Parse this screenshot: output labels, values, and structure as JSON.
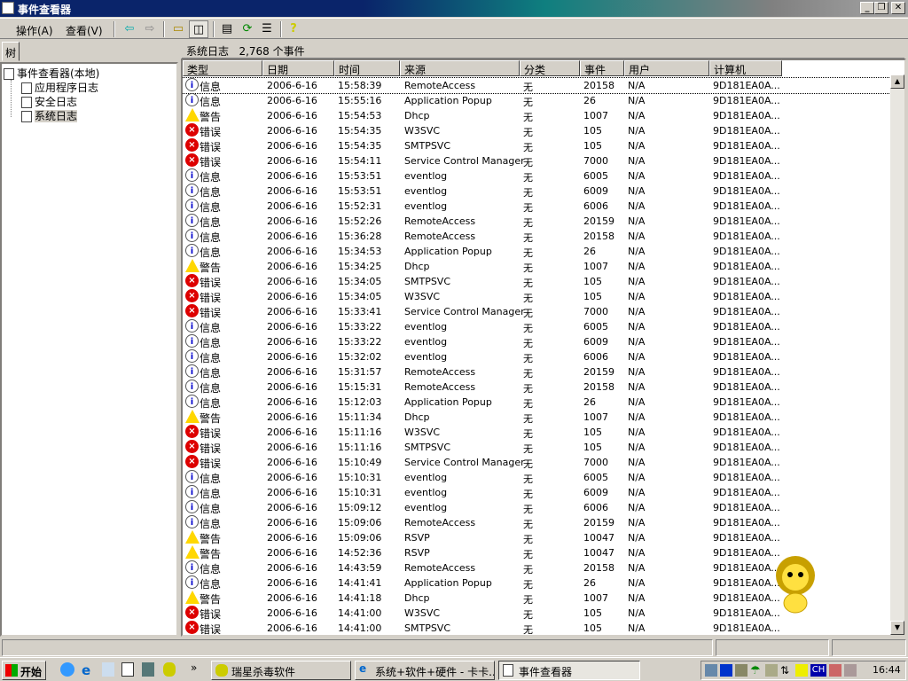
{
  "window": {
    "title": "事件查看器"
  },
  "menu": {
    "action": "操作(A)",
    "view": "查看(V)"
  },
  "tree": {
    "tab": "树",
    "root": "事件查看器(本地)",
    "items": [
      "应用程序日志",
      "安全日志",
      "系统日志"
    ]
  },
  "list": {
    "header": "系统日志   2,768 个事件",
    "columns": [
      "类型",
      "日期",
      "时间",
      "来源",
      "分类",
      "事件",
      "用户",
      "计算机"
    ],
    "rows": [
      [
        "信息",
        "2006-6-16",
        "15:58:39",
        "RemoteAccess",
        "无",
        "20158",
        "N/A",
        "9D181EA0A..."
      ],
      [
        "信息",
        "2006-6-16",
        "15:55:16",
        "Application Popup",
        "无",
        "26",
        "N/A",
        "9D181EA0A..."
      ],
      [
        "警告",
        "2006-6-16",
        "15:54:53",
        "Dhcp",
        "无",
        "1007",
        "N/A",
        "9D181EA0A..."
      ],
      [
        "错误",
        "2006-6-16",
        "15:54:35",
        "W3SVC",
        "无",
        "105",
        "N/A",
        "9D181EA0A..."
      ],
      [
        "错误",
        "2006-6-16",
        "15:54:35",
        "SMTPSVC",
        "无",
        "105",
        "N/A",
        "9D181EA0A..."
      ],
      [
        "错误",
        "2006-6-16",
        "15:54:11",
        "Service Control Manager",
        "无",
        "7000",
        "N/A",
        "9D181EA0A..."
      ],
      [
        "信息",
        "2006-6-16",
        "15:53:51",
        "eventlog",
        "无",
        "6005",
        "N/A",
        "9D181EA0A..."
      ],
      [
        "信息",
        "2006-6-16",
        "15:53:51",
        "eventlog",
        "无",
        "6009",
        "N/A",
        "9D181EA0A..."
      ],
      [
        "信息",
        "2006-6-16",
        "15:52:31",
        "eventlog",
        "无",
        "6006",
        "N/A",
        "9D181EA0A..."
      ],
      [
        "信息",
        "2006-6-16",
        "15:52:26",
        "RemoteAccess",
        "无",
        "20159",
        "N/A",
        "9D181EA0A..."
      ],
      [
        "信息",
        "2006-6-16",
        "15:36:28",
        "RemoteAccess",
        "无",
        "20158",
        "N/A",
        "9D181EA0A..."
      ],
      [
        "信息",
        "2006-6-16",
        "15:34:53",
        "Application Popup",
        "无",
        "26",
        "N/A",
        "9D181EA0A..."
      ],
      [
        "警告",
        "2006-6-16",
        "15:34:25",
        "Dhcp",
        "无",
        "1007",
        "N/A",
        "9D181EA0A..."
      ],
      [
        "错误",
        "2006-6-16",
        "15:34:05",
        "SMTPSVC",
        "无",
        "105",
        "N/A",
        "9D181EA0A..."
      ],
      [
        "错误",
        "2006-6-16",
        "15:34:05",
        "W3SVC",
        "无",
        "105",
        "N/A",
        "9D181EA0A..."
      ],
      [
        "错误",
        "2006-6-16",
        "15:33:41",
        "Service Control Manager",
        "无",
        "7000",
        "N/A",
        "9D181EA0A..."
      ],
      [
        "信息",
        "2006-6-16",
        "15:33:22",
        "eventlog",
        "无",
        "6005",
        "N/A",
        "9D181EA0A..."
      ],
      [
        "信息",
        "2006-6-16",
        "15:33:22",
        "eventlog",
        "无",
        "6009",
        "N/A",
        "9D181EA0A..."
      ],
      [
        "信息",
        "2006-6-16",
        "15:32:02",
        "eventlog",
        "无",
        "6006",
        "N/A",
        "9D181EA0A..."
      ],
      [
        "信息",
        "2006-6-16",
        "15:31:57",
        "RemoteAccess",
        "无",
        "20159",
        "N/A",
        "9D181EA0A..."
      ],
      [
        "信息",
        "2006-6-16",
        "15:15:31",
        "RemoteAccess",
        "无",
        "20158",
        "N/A",
        "9D181EA0A..."
      ],
      [
        "信息",
        "2006-6-16",
        "15:12:03",
        "Application Popup",
        "无",
        "26",
        "N/A",
        "9D181EA0A..."
      ],
      [
        "警告",
        "2006-6-16",
        "15:11:34",
        "Dhcp",
        "无",
        "1007",
        "N/A",
        "9D181EA0A..."
      ],
      [
        "错误",
        "2006-6-16",
        "15:11:16",
        "W3SVC",
        "无",
        "105",
        "N/A",
        "9D181EA0A..."
      ],
      [
        "错误",
        "2006-6-16",
        "15:11:16",
        "SMTPSVC",
        "无",
        "105",
        "N/A",
        "9D181EA0A..."
      ],
      [
        "错误",
        "2006-6-16",
        "15:10:49",
        "Service Control Manager",
        "无",
        "7000",
        "N/A",
        "9D181EA0A..."
      ],
      [
        "信息",
        "2006-6-16",
        "15:10:31",
        "eventlog",
        "无",
        "6005",
        "N/A",
        "9D181EA0A..."
      ],
      [
        "信息",
        "2006-6-16",
        "15:10:31",
        "eventlog",
        "无",
        "6009",
        "N/A",
        "9D181EA0A..."
      ],
      [
        "信息",
        "2006-6-16",
        "15:09:12",
        "eventlog",
        "无",
        "6006",
        "N/A",
        "9D181EA0A..."
      ],
      [
        "信息",
        "2006-6-16",
        "15:09:06",
        "RemoteAccess",
        "无",
        "20159",
        "N/A",
        "9D181EA0A..."
      ],
      [
        "警告",
        "2006-6-16",
        "15:09:06",
        "RSVP",
        "无",
        "10047",
        "N/A",
        "9D181EA0A..."
      ],
      [
        "警告",
        "2006-6-16",
        "14:52:36",
        "RSVP",
        "无",
        "10047",
        "N/A",
        "9D181EA0A..."
      ],
      [
        "信息",
        "2006-6-16",
        "14:43:59",
        "RemoteAccess",
        "无",
        "20158",
        "N/A",
        "9D181EA0A..."
      ],
      [
        "信息",
        "2006-6-16",
        "14:41:41",
        "Application Popup",
        "无",
        "26",
        "N/A",
        "9D181EA0A..."
      ],
      [
        "警告",
        "2006-6-16",
        "14:41:18",
        "Dhcp",
        "无",
        "1007",
        "N/A",
        "9D181EA0A..."
      ],
      [
        "错误",
        "2006-6-16",
        "14:41:00",
        "W3SVC",
        "无",
        "105",
        "N/A",
        "9D181EA0A..."
      ],
      [
        "错误",
        "2006-6-16",
        "14:41:00",
        "SMTPSVC",
        "无",
        "105",
        "N/A",
        "9D181EA0A..."
      ]
    ]
  },
  "taskbar": {
    "start": "开始",
    "tasks": [
      "瑞星杀毒软件",
      "系统+软件+硬件 - 卡卡...",
      "事件查看器"
    ],
    "clock": "16:44",
    "ime": "CH",
    "more": "»"
  }
}
